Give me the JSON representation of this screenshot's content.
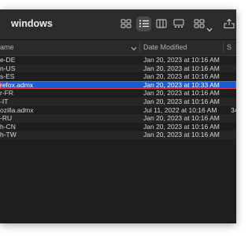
{
  "window": {
    "title": "windows"
  },
  "toolbar": {
    "icons": [
      "icon-view-icon",
      "list-view-icon",
      "column-view-icon",
      "gallery-view-icon",
      "group-icon",
      "share-icon"
    ]
  },
  "columns": {
    "name": "ame",
    "date_modified": "Date Modified",
    "size": "S"
  },
  "rows": [
    {
      "name": "e-DE",
      "date": "Jan 20, 2023 at 10:16 AM",
      "size": ""
    },
    {
      "name": "n-US",
      "date": "Jan 20, 2023 at 10:16 AM",
      "size": ""
    },
    {
      "name": "s-ES",
      "date": "Jan 20, 2023 at 10:16 AM",
      "size": ""
    },
    {
      "name": "refox.admx",
      "date": "Jan 20, 2023 at 10:33 AM",
      "size": "",
      "selected": true
    },
    {
      "name": "r-FR",
      "date": "Jan 20, 2023 at 10:16 AM",
      "size": ""
    },
    {
      "name": "-IT",
      "date": "Jan 20, 2023 at 10:16 AM",
      "size": ""
    },
    {
      "name": "ozilla.admx",
      "date": "Jul 11, 2022 at 10:16 AM",
      "size": "34"
    },
    {
      "name": "-RU",
      "date": "Jan 20, 2023 at 10:16 AM",
      "size": ""
    },
    {
      "name": "h-CN",
      "date": "Jan 20, 2023 at 10:16 AM",
      "size": ""
    },
    {
      "name": "h-TW",
      "date": "Jan 20, 2023 at 10:16 AM",
      "size": ""
    }
  ]
}
